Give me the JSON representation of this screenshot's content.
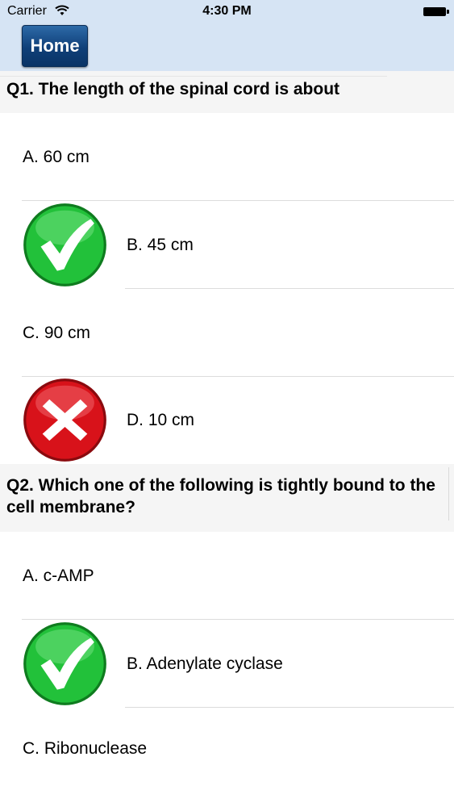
{
  "status_bar": {
    "carrier": "Carrier",
    "time": "4:30 PM"
  },
  "header": {
    "home_label": "Home"
  },
  "questions": [
    {
      "title": "Q1. The length of the spinal cord is about",
      "options": [
        {
          "label": "A. 60 cm",
          "mark": ""
        },
        {
          "label": "B. 45 cm",
          "mark": "correct-check"
        },
        {
          "label": "C. 90 cm",
          "mark": ""
        },
        {
          "label": "D. 10 cm",
          "mark": "wrong-cross"
        }
      ]
    },
    {
      "title": "Q2. Which one of the following is tightly bound to the cell membrane?",
      "options": [
        {
          "label": "A. c-AMP",
          "mark": ""
        },
        {
          "label": "B. Adenylate cyclase",
          "mark": "correct-check"
        },
        {
          "label": "C. Ribonuclease",
          "mark": ""
        }
      ]
    }
  ],
  "colors": {
    "nav_bar": "#d6e4f4",
    "home_button": "#0f3f78",
    "correct": "#22c13a",
    "wrong": "#d8121a"
  }
}
